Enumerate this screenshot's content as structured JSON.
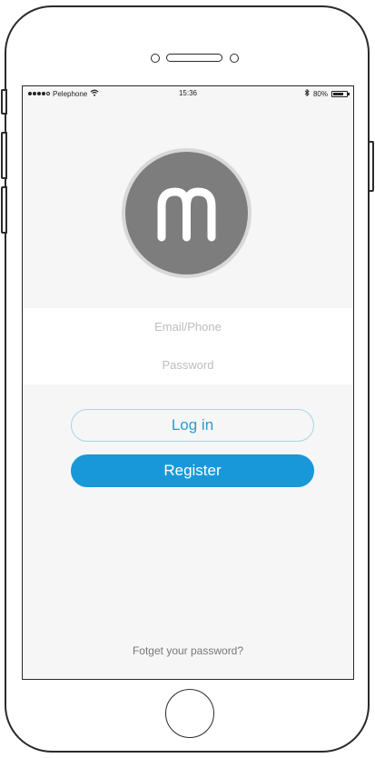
{
  "status_bar": {
    "carrier": "Pelephone",
    "time": "15:36",
    "battery": "80%"
  },
  "logo": {
    "letter": "m"
  },
  "form": {
    "email_placeholder": "Email/Phone",
    "password_placeholder": "Password"
  },
  "buttons": {
    "login": "Log in",
    "register": "Register"
  },
  "footer": {
    "forgot_link": "Fotget your password?"
  },
  "colors": {
    "accent": "#1898d8",
    "login_text": "#2a9bd3",
    "logo_bg": "#7d7d7d",
    "screen_bg": "#f6f6f6"
  }
}
